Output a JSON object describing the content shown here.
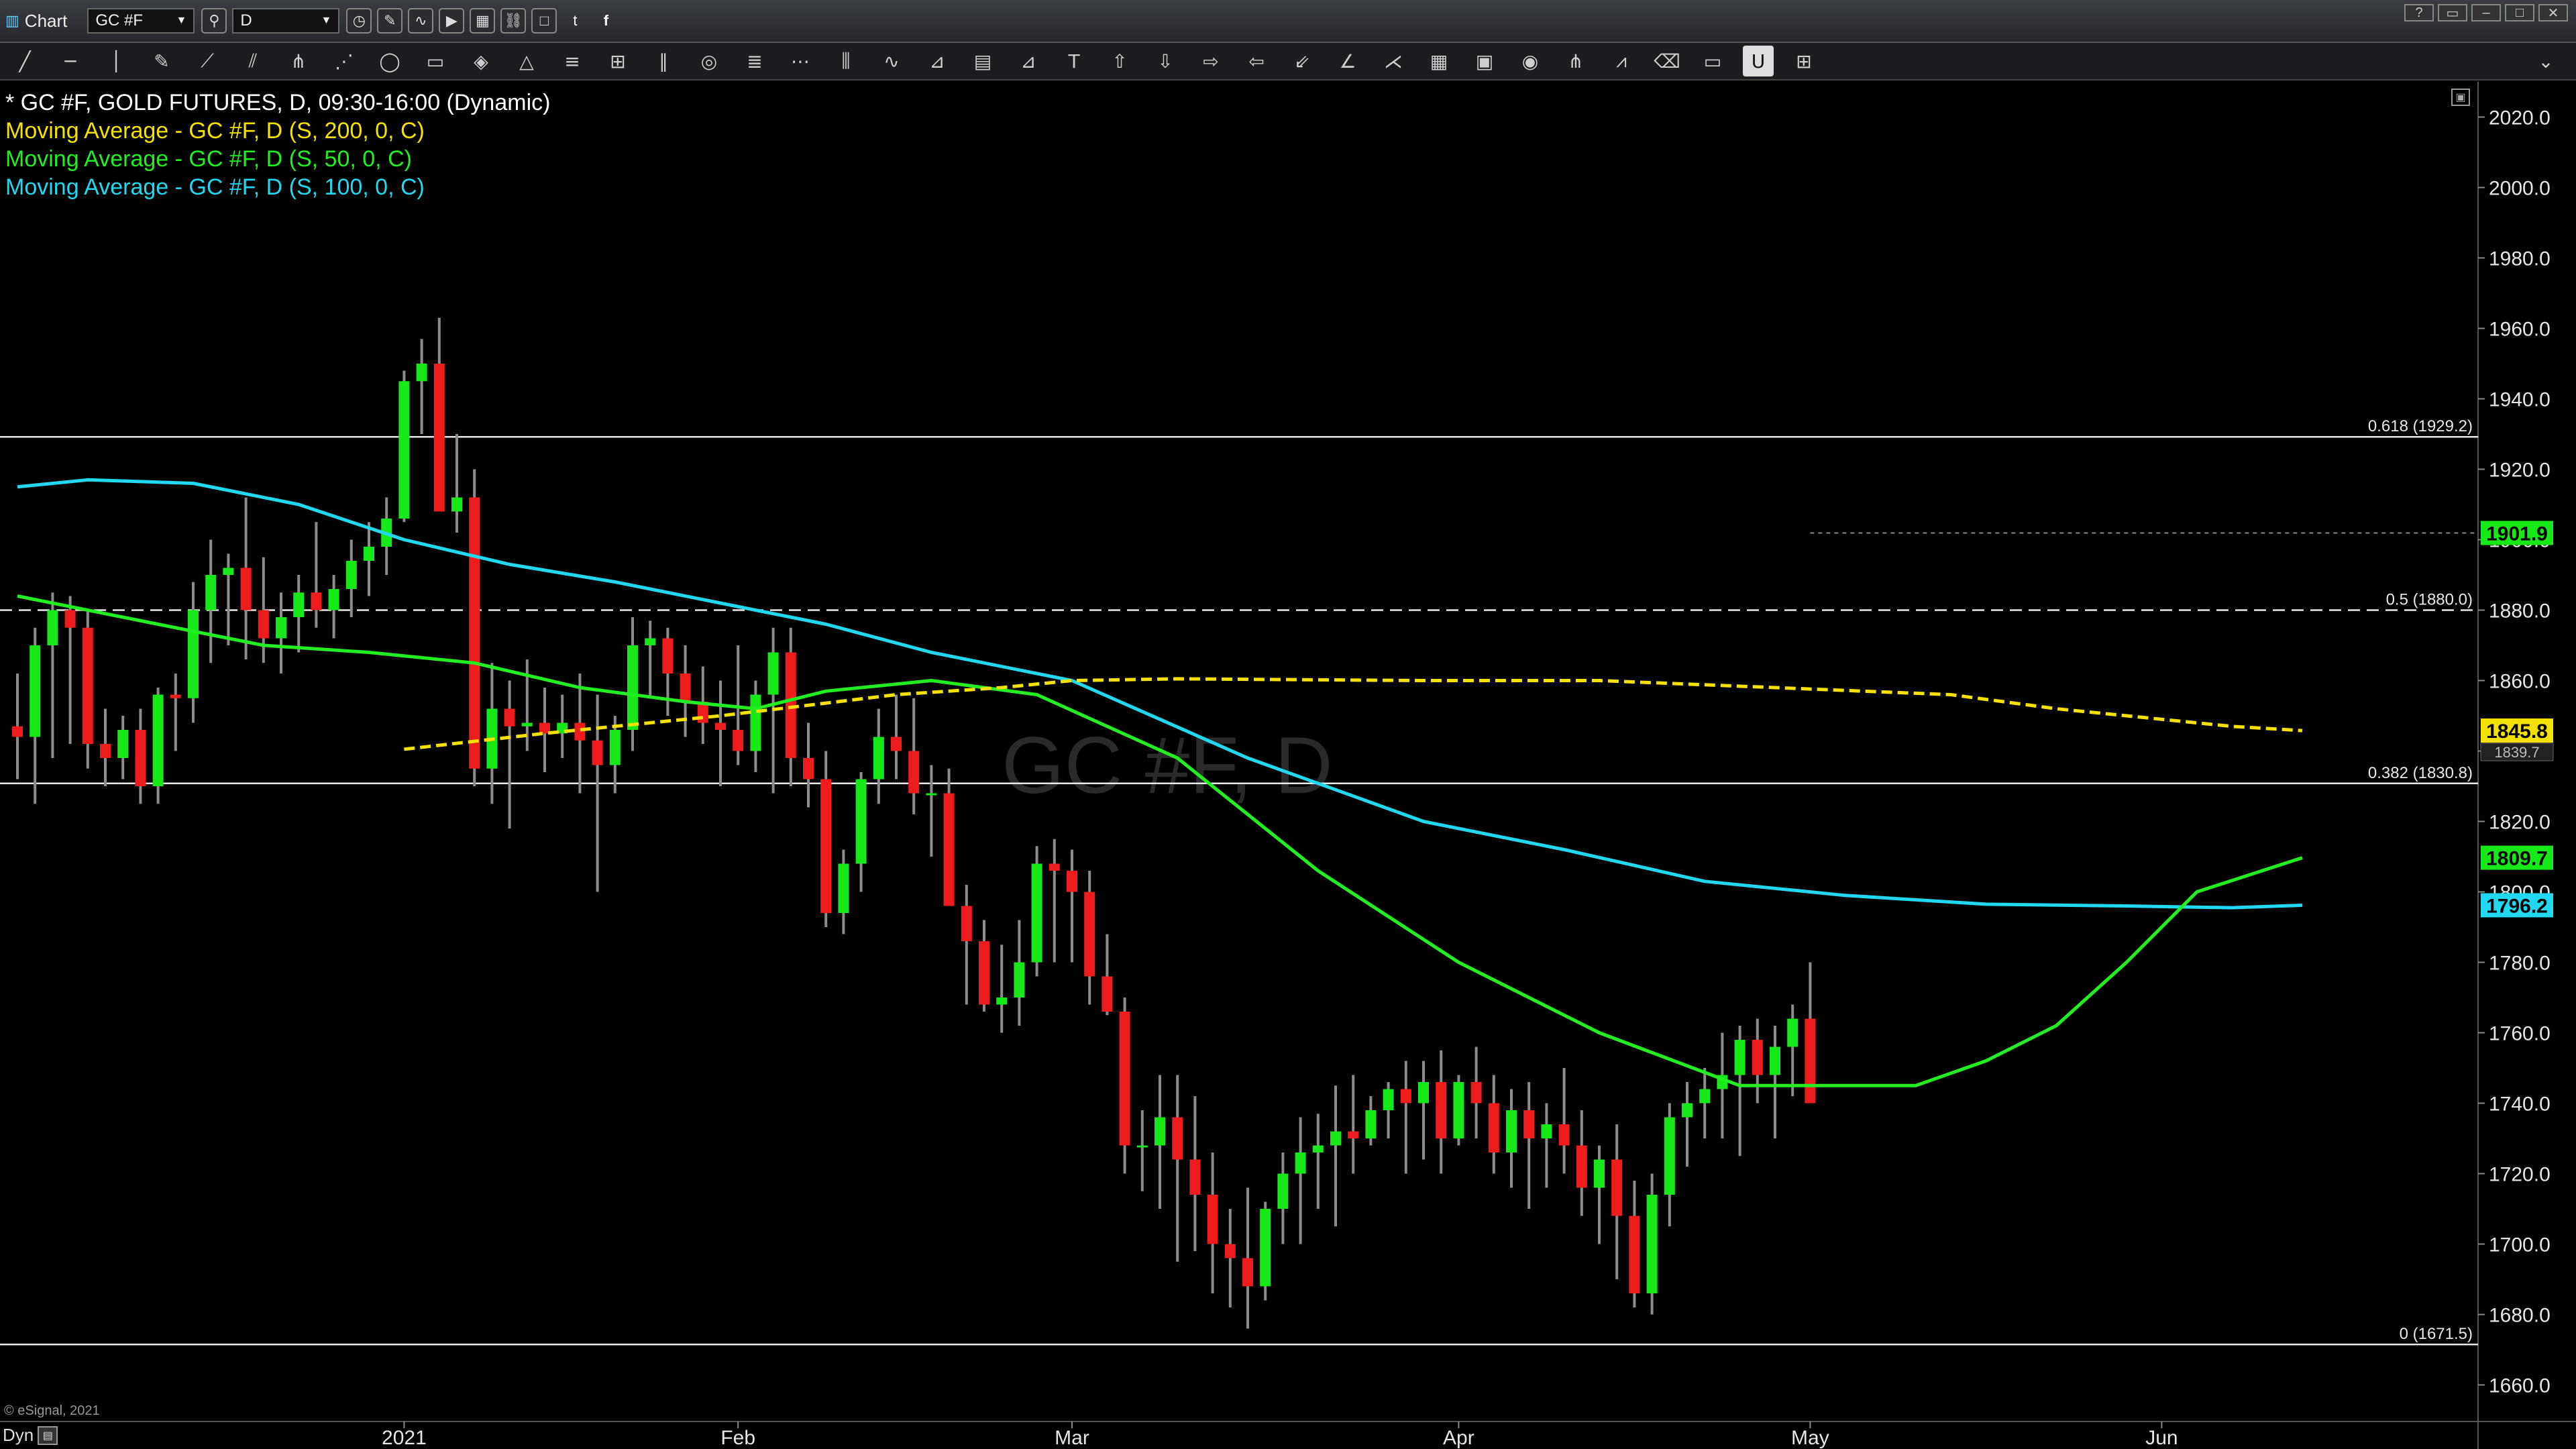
{
  "window": {
    "app_label": "Chart",
    "symbol": "GC #F",
    "interval": "D"
  },
  "toolbar_icons": [
    "line-tool-icon",
    "hline-tool-icon",
    "vline-tool-icon",
    "pencil-tool-icon",
    "trend-tool-icon",
    "channel-tool-icon",
    "fork-tool-icon",
    "fan-tool-icon",
    "ellipse-tool-icon",
    "rectangle-tool-icon",
    "eraser-tool-icon",
    "triangle-tool-icon",
    "fib-retracement-icon",
    "cycle-tool-icon",
    "parallel-lines-icon",
    "spiral-icon",
    "fib-levels-icon",
    "speed-lines-icon",
    "time-zones-icon",
    "wave-icon",
    "gann-icon",
    "gann-box-icon",
    "gann-fan-icon",
    "text-tool-icon",
    "arrow-up-icon",
    "arrow-down-icon",
    "arrow-right-icon",
    "arrow-left-icon",
    "arrow-down-left-icon",
    "angle-icon",
    "arrow-fan-icon",
    "grid-icon",
    "mob-icon",
    "eye-icon",
    "pitchfork-icon",
    "zigzag-icon",
    "erase-all-icon",
    "comment-icon",
    "magnet-icon",
    "settings-grid-icon"
  ],
  "legend": {
    "title": "* GC #F, GOLD FUTURES, D, 09:30-16:00 (Dynamic)",
    "ma200": "Moving Average - GC #F, D (S, 200, 0, C)",
    "ma50": "Moving Average - GC #F, D (S, 50, 0, C)",
    "ma100": "Moving Average - GC #F, D (S, 100, 0, C)"
  },
  "watermark": "GC #F, D",
  "footer": {
    "copyright": "© eSignal, 2021",
    "dyn_label": "Dyn"
  },
  "colors": {
    "up": "#17e817",
    "down": "#ee1c1c",
    "wick": "#8c8c8c",
    "ma200": "#f5e100",
    "ma50": "#22ee22",
    "ma100": "#22d8f0",
    "grid": "#333333"
  },
  "chart_data": {
    "type": "candlestick",
    "ylim": [
      1650,
      2030
    ],
    "yticks": [
      1660,
      1680,
      1700,
      1720,
      1740,
      1760,
      1780,
      1800,
      1820,
      1840,
      1860,
      1880,
      1900,
      1920,
      1940,
      1960,
      1980,
      2000,
      2020
    ],
    "xticks": [
      {
        "label": "2021",
        "index": 22
      },
      {
        "label": "Feb",
        "index": 41
      },
      {
        "label": "Mar",
        "index": 60
      },
      {
        "label": "Apr",
        "index": 82
      },
      {
        "label": "May",
        "index": 102
      },
      {
        "label": "Jun",
        "index": 122
      }
    ],
    "price_markers": [
      {
        "label": "1901.9",
        "value": 1901.9,
        "color": "#17e817",
        "text": "#000"
      },
      {
        "label": "1845.8",
        "value": 1845.8,
        "color": "#f5e100",
        "text": "#000"
      },
      {
        "label": "1839.7",
        "value": 1839.7,
        "color": "#222",
        "text": "#bbb"
      },
      {
        "label": "1809.7",
        "value": 1809.7,
        "color": "#17e817",
        "text": "#000"
      },
      {
        "label": "1796.2",
        "value": 1796.2,
        "color": "#22d8f0",
        "text": "#000"
      }
    ],
    "fib_levels": [
      {
        "label": "0.618 (1929.2)",
        "value": 1929.2,
        "dashed": false
      },
      {
        "label": "0.5 (1880.0)",
        "value": 1880.0,
        "dashed": true
      },
      {
        "label": "0.382 (1830.8)",
        "value": 1830.8,
        "dashed": false
      },
      {
        "label": "0 (1671.5)",
        "value": 1671.5,
        "dashed": false
      }
    ],
    "candles": [
      [
        1847,
        1862,
        1832,
        1844
      ],
      [
        1844,
        1875,
        1825,
        1870
      ],
      [
        1870,
        1885,
        1838,
        1880
      ],
      [
        1880,
        1884,
        1842,
        1875
      ],
      [
        1875,
        1880,
        1835,
        1842
      ],
      [
        1842,
        1852,
        1830,
        1838
      ],
      [
        1838,
        1850,
        1832,
        1846
      ],
      [
        1846,
        1852,
        1825,
        1830
      ],
      [
        1830,
        1858,
        1825,
        1856
      ],
      [
        1856,
        1862,
        1840,
        1855
      ],
      [
        1855,
        1888,
        1848,
        1880
      ],
      [
        1880,
        1900,
        1865,
        1890
      ],
      [
        1890,
        1896,
        1870,
        1892
      ],
      [
        1892,
        1912,
        1866,
        1880
      ],
      [
        1880,
        1895,
        1865,
        1872
      ],
      [
        1872,
        1885,
        1862,
        1878
      ],
      [
        1878,
        1890,
        1868,
        1885
      ],
      [
        1885,
        1905,
        1875,
        1880
      ],
      [
        1880,
        1890,
        1872,
        1886
      ],
      [
        1886,
        1900,
        1878,
        1894
      ],
      [
        1894,
        1905,
        1884,
        1898
      ],
      [
        1898,
        1912,
        1890,
        1906
      ],
      [
        1906,
        1948,
        1905,
        1945
      ],
      [
        1945,
        1957,
        1930,
        1950
      ],
      [
        1950,
        1963,
        1910,
        1908
      ],
      [
        1908,
        1930,
        1902,
        1912
      ],
      [
        1912,
        1920,
        1830,
        1835
      ],
      [
        1835,
        1865,
        1825,
        1852
      ],
      [
        1852,
        1860,
        1818,
        1847
      ],
      [
        1847,
        1866,
        1840,
        1848
      ],
      [
        1848,
        1858,
        1834,
        1845
      ],
      [
        1845,
        1856,
        1838,
        1848
      ],
      [
        1848,
        1862,
        1828,
        1843
      ],
      [
        1843,
        1856,
        1800,
        1836
      ],
      [
        1836,
        1850,
        1828,
        1846
      ],
      [
        1846,
        1878,
        1840,
        1870
      ],
      [
        1870,
        1877,
        1855,
        1872
      ],
      [
        1872,
        1875,
        1850,
        1862
      ],
      [
        1862,
        1870,
        1844,
        1854
      ],
      [
        1854,
        1864,
        1842,
        1848
      ],
      [
        1848,
        1860,
        1830,
        1846
      ],
      [
        1846,
        1870,
        1836,
        1840
      ],
      [
        1840,
        1860,
        1834,
        1856
      ],
      [
        1856,
        1875,
        1828,
        1868
      ],
      [
        1868,
        1875,
        1830,
        1838
      ],
      [
        1838,
        1848,
        1824,
        1832
      ],
      [
        1832,
        1840,
        1790,
        1794
      ],
      [
        1794,
        1812,
        1788,
        1808
      ],
      [
        1808,
        1834,
        1800,
        1832
      ],
      [
        1832,
        1852,
        1825,
        1844
      ],
      [
        1844,
        1856,
        1832,
        1840
      ],
      [
        1840,
        1855,
        1822,
        1828
      ],
      [
        1828,
        1836,
        1810,
        1828
      ],
      [
        1828,
        1835,
        1802,
        1796
      ],
      [
        1796,
        1802,
        1768,
        1786
      ],
      [
        1786,
        1792,
        1766,
        1768
      ],
      [
        1768,
        1785,
        1760,
        1770
      ],
      [
        1770,
        1792,
        1762,
        1780
      ],
      [
        1780,
        1813,
        1776,
        1808
      ],
      [
        1808,
        1815,
        1780,
        1806
      ],
      [
        1806,
        1812,
        1780,
        1800
      ],
      [
        1800,
        1806,
        1768,
        1776
      ],
      [
        1776,
        1788,
        1765,
        1766
      ],
      [
        1766,
        1770,
        1720,
        1728
      ],
      [
        1728,
        1738,
        1715,
        1728
      ],
      [
        1728,
        1748,
        1710,
        1736
      ],
      [
        1736,
        1748,
        1695,
        1724
      ],
      [
        1724,
        1742,
        1698,
        1714
      ],
      [
        1714,
        1726,
        1686,
        1700
      ],
      [
        1700,
        1710,
        1682,
        1696
      ],
      [
        1696,
        1716,
        1676,
        1688
      ],
      [
        1688,
        1712,
        1684,
        1710
      ],
      [
        1710,
        1726,
        1700,
        1720
      ],
      [
        1720,
        1736,
        1700,
        1726
      ],
      [
        1726,
        1737,
        1710,
        1728
      ],
      [
        1728,
        1745,
        1705,
        1732
      ],
      [
        1732,
        1748,
        1720,
        1730
      ],
      [
        1730,
        1742,
        1728,
        1738
      ],
      [
        1738,
        1746,
        1730,
        1744
      ],
      [
        1744,
        1752,
        1720,
        1740
      ],
      [
        1740,
        1752,
        1724,
        1746
      ],
      [
        1746,
        1755,
        1720,
        1730
      ],
      [
        1730,
        1748,
        1728,
        1746
      ],
      [
        1746,
        1756,
        1730,
        1740
      ],
      [
        1740,
        1748,
        1720,
        1726
      ],
      [
        1726,
        1744,
        1716,
        1738
      ],
      [
        1738,
        1746,
        1710,
        1730
      ],
      [
        1730,
        1740,
        1716,
        1734
      ],
      [
        1734,
        1750,
        1720,
        1728
      ],
      [
        1728,
        1738,
        1708,
        1716
      ],
      [
        1716,
        1728,
        1700,
        1724
      ],
      [
        1724,
        1734,
        1690,
        1708
      ],
      [
        1708,
        1718,
        1682,
        1686
      ],
      [
        1686,
        1720,
        1680,
        1714
      ],
      [
        1714,
        1740,
        1705,
        1736
      ],
      [
        1736,
        1746,
        1722,
        1740
      ],
      [
        1740,
        1750,
        1730,
        1744
      ],
      [
        1744,
        1760,
        1730,
        1748
      ],
      [
        1748,
        1762,
        1725,
        1758
      ],
      [
        1758,
        1764,
        1740,
        1748
      ],
      [
        1748,
        1762,
        1730,
        1756
      ],
      [
        1756,
        1768,
        1742,
        1764
      ],
      [
        1764,
        1780,
        1745,
        1740
      ]
    ],
    "ma200": [
      [
        22,
        1840.5
      ],
      [
        30,
        1845
      ],
      [
        40,
        1850
      ],
      [
        50,
        1856
      ],
      [
        56,
        1858
      ],
      [
        60,
        1860
      ],
      [
        66,
        1860.5
      ],
      [
        80,
        1860
      ],
      [
        90,
        1860
      ],
      [
        100,
        1858
      ],
      [
        110,
        1856
      ],
      [
        116,
        1852
      ],
      [
        120,
        1850
      ],
      [
        126,
        1847
      ],
      [
        130,
        1845.8
      ]
    ],
    "ma50": [
      [
        0,
        1884
      ],
      [
        8,
        1876
      ],
      [
        14,
        1870
      ],
      [
        20,
        1868
      ],
      [
        26,
        1865
      ],
      [
        32,
        1858
      ],
      [
        38,
        1854
      ],
      [
        42,
        1852
      ],
      [
        46,
        1857
      ],
      [
        52,
        1860
      ],
      [
        58,
        1856
      ],
      [
        66,
        1838
      ],
      [
        74,
        1806
      ],
      [
        82,
        1780
      ],
      [
        90,
        1760
      ],
      [
        98,
        1745
      ],
      [
        104,
        1745
      ],
      [
        108,
        1745
      ],
      [
        112,
        1752
      ],
      [
        116,
        1762
      ],
      [
        120,
        1780
      ],
      [
        124,
        1800
      ],
      [
        130,
        1809.7
      ]
    ],
    "ma100": [
      [
        0,
        1915
      ],
      [
        4,
        1917
      ],
      [
        10,
        1916
      ],
      [
        16,
        1910
      ],
      [
        22,
        1900
      ],
      [
        28,
        1893
      ],
      [
        34,
        1888
      ],
      [
        40,
        1882
      ],
      [
        46,
        1876
      ],
      [
        52,
        1868
      ],
      [
        60,
        1860
      ],
      [
        70,
        1838
      ],
      [
        80,
        1820
      ],
      [
        88,
        1812
      ],
      [
        96,
        1803
      ],
      [
        104,
        1799
      ],
      [
        112,
        1796.5
      ],
      [
        120,
        1796
      ],
      [
        126,
        1795.5
      ],
      [
        130,
        1796.2
      ]
    ]
  }
}
